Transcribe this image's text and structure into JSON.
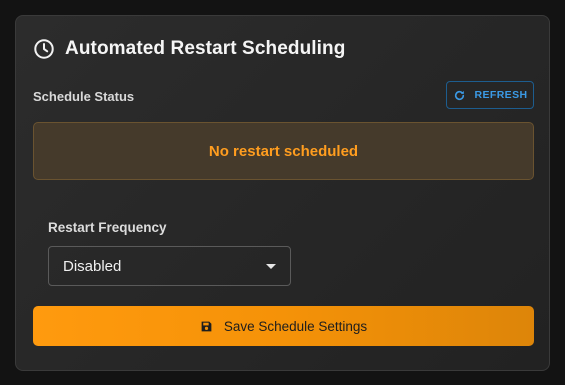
{
  "card": {
    "title": "Automated Restart Scheduling",
    "icon": "clock-icon"
  },
  "status": {
    "label": "Schedule Status",
    "refresh_label": "REFRESH",
    "refresh_icon": "refresh-icon",
    "message": "No restart scheduled"
  },
  "frequency": {
    "label": "Restart Frequency",
    "selected": "Disabled",
    "caret_icon": "chevron-down-icon"
  },
  "save": {
    "label": "Save Schedule Settings",
    "icon": "floppy-disk-icon"
  },
  "colors": {
    "accent": "#ff9a0e",
    "status_text": "#ff9d1f",
    "refresh_blue": "#3b9ae6"
  }
}
